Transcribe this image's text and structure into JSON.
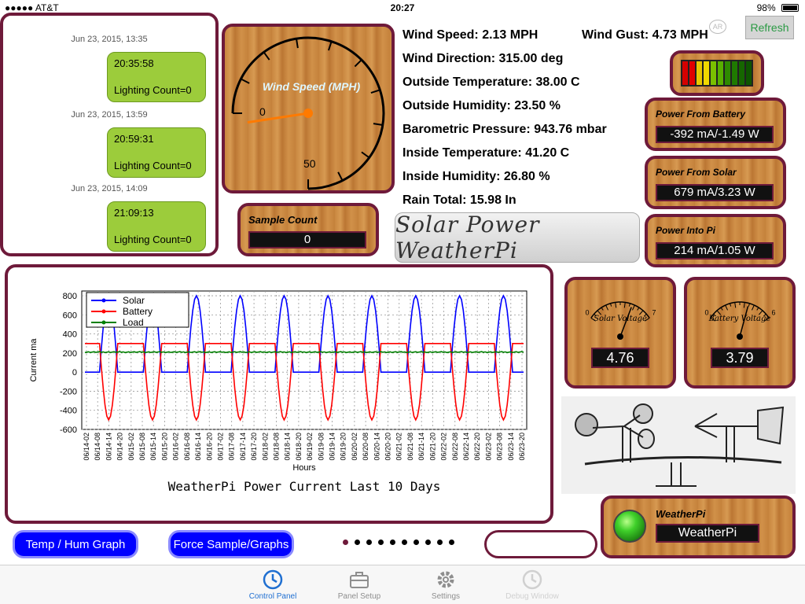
{
  "status_bar": {
    "carrier": "●●●●● AT&T",
    "time": "20:27",
    "battery": "98%"
  },
  "messages": [
    {
      "date": "Jun 23, 2015, 13:35",
      "time": "20:35:58",
      "text": "Lighting Count=0"
    },
    {
      "date": "Jun 23, 2015, 13:59",
      "time": "20:59:31",
      "text": "Lighting Count=0"
    },
    {
      "date": "Jun 23, 2015, 14:09",
      "time": "21:09:13",
      "text": "Lighting Count=0"
    }
  ],
  "wind_gauge": {
    "title": "Wind Speed (MPH)",
    "min_label": "0",
    "max_label": "50",
    "value": 2.13,
    "max": 50
  },
  "readouts": {
    "wind_speed": "Wind Speed: 2.13 MPH",
    "wind_gust": "Wind Gust: 4.73 MPH",
    "wind_direction": "Wind Direction: 315.00 deg",
    "outside_temp": "Outside Temperature: 38.00 C",
    "outside_humidity": "Outside Humidity: 23.50 %",
    "pressure": "Barometric Pressure: 943.76 mbar",
    "inside_temp": "Inside Temperature: 41.20 C",
    "inside_humidity": "Inside Humidity: 26.80 %",
    "rain_total": "Rain Total: 15.98 In"
  },
  "refresh_label": "Refresh",
  "ar_label": "AR",
  "led_colors": [
    "#d40000",
    "#e00000",
    "#e8c800",
    "#f0d800",
    "#7ac000",
    "#58b000",
    "#2e8a00",
    "#1f7a00",
    "#166600",
    "#0e5500"
  ],
  "power": {
    "battery": {
      "label": "Power From Battery",
      "value": "-392 mA/-1.49 W"
    },
    "solar": {
      "label": "Power From Solar",
      "value": "679 mA/3.23 W"
    },
    "pi": {
      "label": "Power Into Pi",
      "value": "214 mA/1.05 W"
    }
  },
  "sample": {
    "label": "Sample Count",
    "value": "0"
  },
  "logo_text": "Solar Power WeatherPi",
  "voltage": {
    "solar": {
      "label": "Solar Voltage",
      "value": "4.76",
      "min_label": "0",
      "max_label": "7",
      "level": 4.76,
      "max": 7
    },
    "battery": {
      "label": "Battery Voltage",
      "value": "3.79",
      "min_label": "0",
      "max_label": "6",
      "level": 3.79,
      "max": 6
    }
  },
  "weatherpi": {
    "label": "WeatherPi",
    "value": "WeatherPi"
  },
  "buttons": {
    "temp_hum": "Temp / Hum Graph",
    "force_sample": "Force Sample/Graphs"
  },
  "page_dots": {
    "count": 10,
    "active": 0
  },
  "tabs": [
    {
      "label": "Control Panel",
      "icon": "clock-icon",
      "state": "active"
    },
    {
      "label": "Panel Setup",
      "icon": "toolbox-icon",
      "state": "normal"
    },
    {
      "label": "Settings",
      "icon": "gear-icon",
      "state": "normal"
    },
    {
      "label": "Debug Window",
      "icon": "clock-icon",
      "state": "disabled"
    }
  ],
  "chart_data": {
    "type": "line",
    "title": "WeatherPi Power Current Last 10 Days",
    "xlabel": "Hours",
    "ylabel": "Current ma",
    "ylim": [
      -600,
      850
    ],
    "yticks": [
      800,
      600,
      400,
      200,
      0,
      -200,
      -400,
      -600
    ],
    "grid": true,
    "legend": "top-left",
    "xticks": [
      "06/14-02",
      "06/14-08",
      "06/14-14",
      "06/14-20",
      "06/15-02",
      "06/15-08",
      "06/15-14",
      "06/15-20",
      "06/16-02",
      "06/16-08",
      "06/16-14",
      "06/16-20",
      "06/17-02",
      "06/17-08",
      "06/17-14",
      "06/17-20",
      "06/18-02",
      "06/18-08",
      "06/18-14",
      "06/18-20",
      "06/19-02",
      "06/19-08",
      "06/19-14",
      "06/19-20",
      "06/20-02",
      "06/20-08",
      "06/20-14",
      "06/20-20",
      "06/21-02",
      "06/21-08",
      "06/21-14",
      "06/21-20",
      "06/22-02",
      "06/22-08",
      "06/22-14",
      "06/22-20",
      "06/23-02",
      "06/23-08",
      "06/23-14",
      "06/23-20"
    ],
    "days": 10,
    "series": [
      {
        "name": "Solar",
        "color": "#0000ff",
        "night": 0,
        "day": 800
      },
      {
        "name": "Battery",
        "color": "#ff0000",
        "night": 300,
        "day": -500
      },
      {
        "name": "Load",
        "color": "#008000",
        "night": 210,
        "day": 210
      }
    ]
  }
}
